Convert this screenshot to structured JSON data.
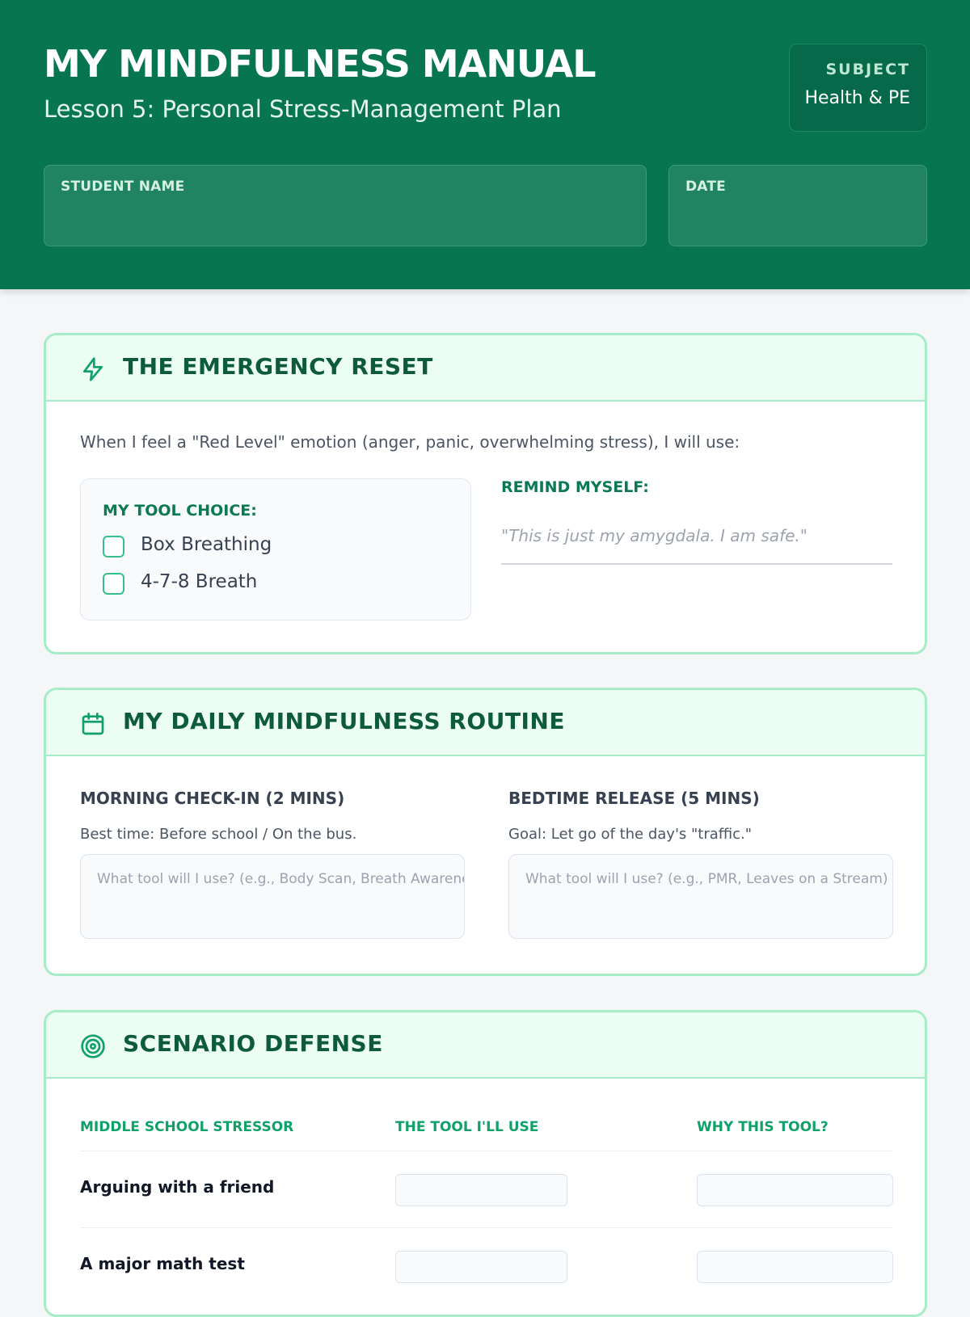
{
  "header": {
    "title": "MY MINDFULNESS MANUAL",
    "subtitle": "Lesson 5: Personal Stress-Management Plan",
    "subject_label": "SUBJECT",
    "subject_value": "Health & PE",
    "student_name_label": "STUDENT NAME",
    "date_label": "DATE",
    "background_color": "#067550"
  },
  "emergency": {
    "icon": "lightning-icon",
    "title": "THE EMERGENCY RESET",
    "intro": "When I feel a \"Red Level\" emotion (anger, panic, overwhelming stress), I will use:",
    "tool_choice_label": "MY TOOL CHOICE:",
    "options": [
      "Box Breathing",
      "4-7-8 Breath"
    ],
    "remind_label": "REMIND MYSELF:",
    "remind_quote": "\"This is just my amygdala. I am safe.\""
  },
  "routine": {
    "icon": "calendar-icon",
    "title": "MY DAILY MINDFULNESS ROUTINE",
    "morning": {
      "title": "MORNING CHECK-IN (2 MINS)",
      "note": "Best time: Before school / On the bus.",
      "placeholder": "What tool will I use? (e.g., Body Scan, Breath Awareness)"
    },
    "bedtime": {
      "title": "BEDTIME RELEASE (5 MINS)",
      "note": "Goal: Let go of the day's \"traffic.\"",
      "placeholder": "What tool will I use? (e.g., PMR, Leaves on a Stream)"
    }
  },
  "scenario": {
    "icon": "target-icon",
    "title": "SCENARIO DEFENSE",
    "columns": [
      "MIDDLE SCHOOL STRESSOR",
      "THE TOOL I'LL USE",
      "WHY THIS TOOL?"
    ],
    "rows": [
      {
        "stressor": "Arguing with a friend"
      },
      {
        "stressor": "A major math test"
      }
    ]
  },
  "colors": {
    "accent": "#10a06a",
    "card_border": "#a6ecc7",
    "card_header_bg": "#ecfdf4"
  }
}
